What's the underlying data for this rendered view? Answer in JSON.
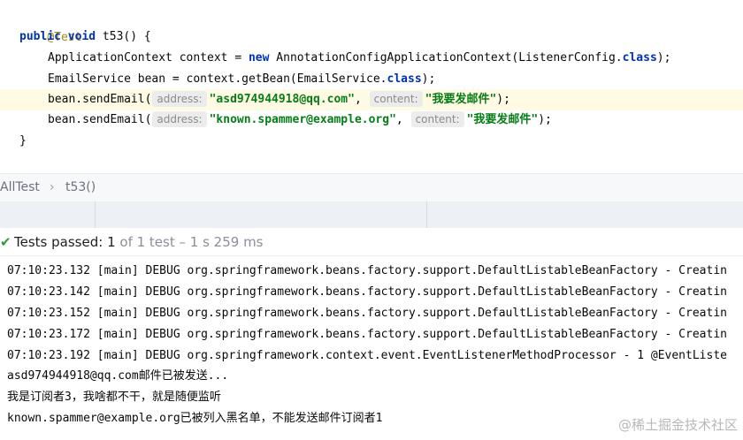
{
  "editor": {
    "lines": {
      "l1": "@Test",
      "l2_kw1": "public",
      "l2_kw2": "void",
      "l2_rest": " t53() {",
      "l3_a": "ApplicationContext context = ",
      "l3_new": "new",
      "l3_b": " AnnotationConfigApplicationContext(ListenerConfig.",
      "l3_class": "class",
      "l3_c": ");",
      "l4_a": "EmailService bean = context.getBean(EmailService.",
      "l4_class": "class",
      "l4_c": ");",
      "l5_a": "bean.sendEmail(",
      "l5_hint1": "address:",
      "l5_str1": "\"asd974944918@qq.com\"",
      "l5_comma": ",",
      "l5_hint2": "content:",
      "l5_str2": "\"我要发邮件\"",
      "l5_end": ");",
      "l6_a": "bean.sendEmail(",
      "l6_hint1": "address:",
      "l6_str1": "\"known.spammer@example.org\"",
      "l6_comma": ",",
      "l6_hint2": "content:",
      "l6_str2": "\"我要发邮件\"",
      "l6_end": ");",
      "l7": "}"
    }
  },
  "breadcrumb": {
    "class_name": "AllTest",
    "separator": "›",
    "method_name": "t53()"
  },
  "status": {
    "check_icon": "✔",
    "passed_label": "Tests passed:",
    "passed_count": "1",
    "detail": "of 1 test – 1 s 259 ms"
  },
  "console": {
    "lines": [
      "07:10:23.132 [main] DEBUG org.springframework.beans.factory.support.DefaultListableBeanFactory - Creatin",
      "07:10:23.142 [main] DEBUG org.springframework.beans.factory.support.DefaultListableBeanFactory - Creatin",
      "07:10:23.152 [main] DEBUG org.springframework.beans.factory.support.DefaultListableBeanFactory - Creatin",
      "07:10:23.172 [main] DEBUG org.springframework.beans.factory.support.DefaultListableBeanFactory - Creatin",
      "07:10:23.192 [main] DEBUG org.springframework.context.event.EventListenerMethodProcessor - 1 @EventListe",
      "asd974944918@qq.com邮件已被发送...",
      "我是订阅者3，我啥都不干，就是随便监听",
      "known.spammer@example.org已被列入黑名单，不能发送邮件订阅者1"
    ]
  },
  "watermark": "@稀土掘金技术社区",
  "colors": {
    "keyword": "#0033b3",
    "string": "#067d17",
    "annotation": "#9e880d",
    "pass_green": "#2b9c3a",
    "highlight_line": "#fffae3"
  }
}
